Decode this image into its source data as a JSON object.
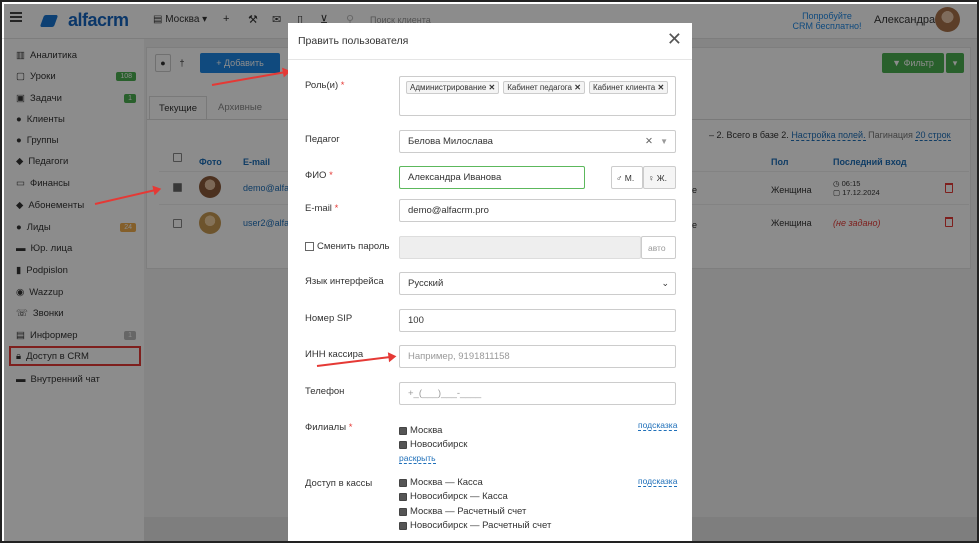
{
  "topbar": {
    "logo": "alfacrm",
    "branch": "Москва",
    "search_placeholder": "Поиск клиента",
    "promo_line1": "Попробуйте",
    "promo_line2": "CRM бесплатно!",
    "user_name": "Александра"
  },
  "sidebar": {
    "items": [
      {
        "label": "Аналитика"
      },
      {
        "label": "Уроки",
        "badge": "108"
      },
      {
        "label": "Задачи",
        "badge": "1"
      },
      {
        "label": "Клиенты"
      },
      {
        "label": "Группы"
      },
      {
        "label": "Педагоги"
      },
      {
        "label": "Финансы"
      },
      {
        "label": "Абонементы"
      },
      {
        "label": "Лиды",
        "badge": "24"
      },
      {
        "label": "Юр. лица"
      },
      {
        "label": "Podpislon"
      },
      {
        "label": "Wazzup"
      },
      {
        "label": "Звонки"
      },
      {
        "label": "Информер",
        "badge": "1"
      },
      {
        "label": "Доступ в CRM"
      },
      {
        "label": "Внутренний чат"
      }
    ],
    "colors": {
      "green_badge": "#4caf50",
      "orange_badge": "#f0ad4e",
      "gray_badge": "#bbb"
    }
  },
  "main": {
    "add_label": "+ Добавить",
    "filter_label": "Фильтр",
    "tabs": [
      "Текущие",
      "Архивные"
    ],
    "summary": "– 2. Всего в базе 2.",
    "fields_link": "Настройка полей.",
    "pagination_label": "Пагинация",
    "pagination_value": "20 строк",
    "columns": {
      "photo": "Фото",
      "email": "E-mail",
      "gender": "Пол",
      "last_login": "Последний вход"
    },
    "rows": [
      {
        "email": "demo@alfa",
        "gender": "Женщина",
        "time": "06:15",
        "date": "17.12.2024",
        "checked": true
      },
      {
        "email": "user2@alfa",
        "gender": "Женщина",
        "not_set": "(не задано)",
        "checked": false
      }
    ],
    "partial_letter": "е"
  },
  "modal": {
    "title": "Править пользователя",
    "roles_label": "Роль(и)",
    "roles": [
      "Администрирование",
      "Кабинет педагога",
      "Кабинет клиента"
    ],
    "teacher_label": "Педагог",
    "teacher_value": "Белова Милослава",
    "fio_label": "ФИО",
    "fio_value": "Александра Иванова",
    "gender_m": "М.",
    "gender_f": "Ж.",
    "email_label": "E-mail",
    "email_value": "demo@alfacrm.pro",
    "change_password_label": "Сменить пароль",
    "auto_label": "авто",
    "language_label": "Язык интерфейса",
    "language_value": "Русский",
    "sip_label": "Номер SIP",
    "sip_value": "100",
    "inn_label": "ИНН кассира",
    "inn_placeholder": "Например, 9191811158",
    "phone_label": "Телефон",
    "phone_placeholder": "+_(___)___-____",
    "branches_label": "Филиалы",
    "branches": [
      "Москва",
      "Новосибирск"
    ],
    "expand_link": "раскрыть",
    "hint_link": "подсказка",
    "cash_access_label": "Доступ в кассы",
    "cash_items": [
      "Москва — Касса",
      "Новосибирск — Касса",
      "Москва — Расчетный счет",
      "Новосибирск — Расчетный счет"
    ]
  }
}
